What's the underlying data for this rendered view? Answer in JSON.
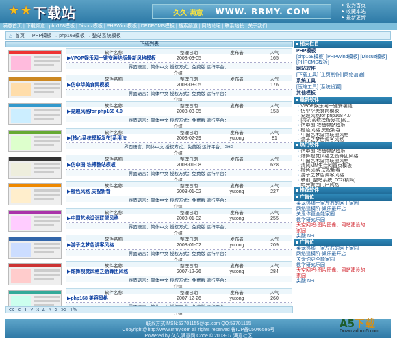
{
  "header": {
    "logo_text": "下载站",
    "slogan": "久久·满意",
    "domain": "WWW. RRMY. COM",
    "links": [
      "设为首页",
      "收藏本站",
      "最新更新"
    ]
  },
  "nav": [
    "满意首页",
    "下载频道",
    "php168模板",
    "Discuz模板",
    "PHPWind模板",
    "DEDECMS模板",
    "搜索频道",
    "网站论坛",
    "联系站长",
    "关于我们"
  ],
  "breadcrumb": [
    "首页",
    "PHP模板",
    "php168模板",
    "整站系统模板"
  ],
  "list_title": "下载列表",
  "col_labels": {
    "name": "软件名称",
    "date": "整理日期",
    "publisher": "发布者",
    "popularity": "人气"
  },
  "info_line": "界面语言：简体中文  授权方式：免费版  运行平台：",
  "intro_label": "介绍:",
  "entries": [
    {
      "title": "▶VPOP娱乐网一键安装绝版最新风格模板",
      "date": "2008-03-05",
      "publisher": "",
      "pop": "165",
      "info": "界面语言：简体中文  授权方式：免费版  运行平台："
    },
    {
      "title": "▶仿中华美食网模板",
      "date": "2008-03-05",
      "publisher": "",
      "pop": "176",
      "info": "界面语言：简体中文  授权方式：免费版  运行平台："
    },
    {
      "title": "▶易趣风格for php168 4.0",
      "date": "2008-03-05",
      "publisher": "",
      "pop": "153",
      "info": "界面语言：简体中文  授权方式：免费版  运行平台："
    },
    {
      "title": "▶[核心系统模板发布]系用法",
      "date": "2008-02-29",
      "publisher": "yutong",
      "pop": "81",
      "info": "界面语言：简体中文  授权方式：免费版  运行平台：PHP"
    },
    {
      "title": "▶仿中国·铁搏整站模板",
      "date": "2008-01-08",
      "publisher": "",
      "pop": "628",
      "info": "界面语言：简体中文  授权方式：免费版  运行平台："
    },
    {
      "title": "▶橙色风格 庆祝新春",
      "date": "2008-01-02",
      "publisher": "yutong",
      "pop": "227",
      "info": "界面语言：简体中文  授权方式：免费版  运行平台："
    },
    {
      "title": "▶中国艺术设计联盟风格",
      "date": "2008-01-02",
      "publisher": "yutong",
      "pop": "255",
      "info": "界面语言：简体中文  授权方式：免费版  运行平台："
    },
    {
      "title": "▶游子之梦色调客风格",
      "date": "2008-01-02",
      "publisher": "yutong",
      "pop": "209",
      "info": "界面语言：简体中文  授权方式：免费版  运行平台："
    },
    {
      "title": "▶炫舞视觉风格之劲舞团风格",
      "date": "2007-12-26",
      "publisher": "yutong",
      "pop": "284",
      "info": "界面语言：简体中文  授权方式：免费版  运行平台："
    },
    {
      "title": "▶php168 美容风格",
      "date": "2007-12-26",
      "publisher": "yutong",
      "pop": "260",
      "info": "界面语言：简体中文  授权方式：免费版  运行平台："
    }
  ],
  "pager": [
    "<<",
    "<",
    "1",
    "2",
    "3",
    "4",
    "5",
    ">",
    ">>",
    "1/5"
  ],
  "sidebar": {
    "category_head": "相关栏目",
    "php_head": "PHP模板",
    "php_links": "[php168模板] [PHPWind模板] [Discuz模板] [PHPCMS模板]",
    "web_head": "网站软件",
    "web_links": "[下载工具] [主页制作] [网络加速]",
    "sys_head": "系统工具",
    "sys_links": "[压缩工具] [系统设置]",
    "other_head": "其他模板",
    "latest_head": "最新软件",
    "latest": [
      "VPOP娱乐网一键安装绝...",
      "仿中华美食网模板",
      "易趣风格for php168 4.0",
      "[核心系统模板发布]系...",
      "仿中国·铁搏整站模板",
      "橙色风格 庆祝新春",
      "中国艺术设计联盟风格",
      "游子之梦色调客风格"
    ],
    "hot_head": "热门软件",
    "hot": [
      "仿中国·铁搏整站模板",
      "炫舞视觉风格之劲舞团风格",
      "中国艺术设计联盟风格",
      "清风MM生活网首页模板",
      "橙色风格 庆祝新春",
      "游子之梦色调客风格",
      "联创_整站系统_002(精简)",
      "经典黄色门户风格"
    ],
    "rec_head": "推荐软件",
    "ad1_head": "广告位",
    "ad1": [
      "莱龙热线一家左右的网上家园",
      "网络建模阶·娱乐最开店",
      "关爱你更全能家园",
      "教学研究乐园",
      "天空网吧·图片图像、网站建设的",
      "家园",
      "尖酸.Net"
    ],
    "ad2_head": "广告位",
    "ad2": [
      "莱龙热线一家左右的网上家园",
      "网络建模阶·娱乐最开店",
      "关爱你更全能家园",
      "教学研究乐园",
      "天空网吧·图片图像、网站建设的",
      "家园",
      "尖酸.Net"
    ]
  },
  "footer": {
    "line1": "联系方式:MSN:53701155@qq.com QQ:53701155",
    "line2": "Copyright@http://www.rrmy.com all rights reserved 鲁ICP备05046595号",
    "line3": "Powered by 久久满意网 Code © 2003-07 满意社区"
  },
  "watermark": {
    "a5": "A5",
    "xz": "下载",
    "url": "Down.admin5.com"
  }
}
